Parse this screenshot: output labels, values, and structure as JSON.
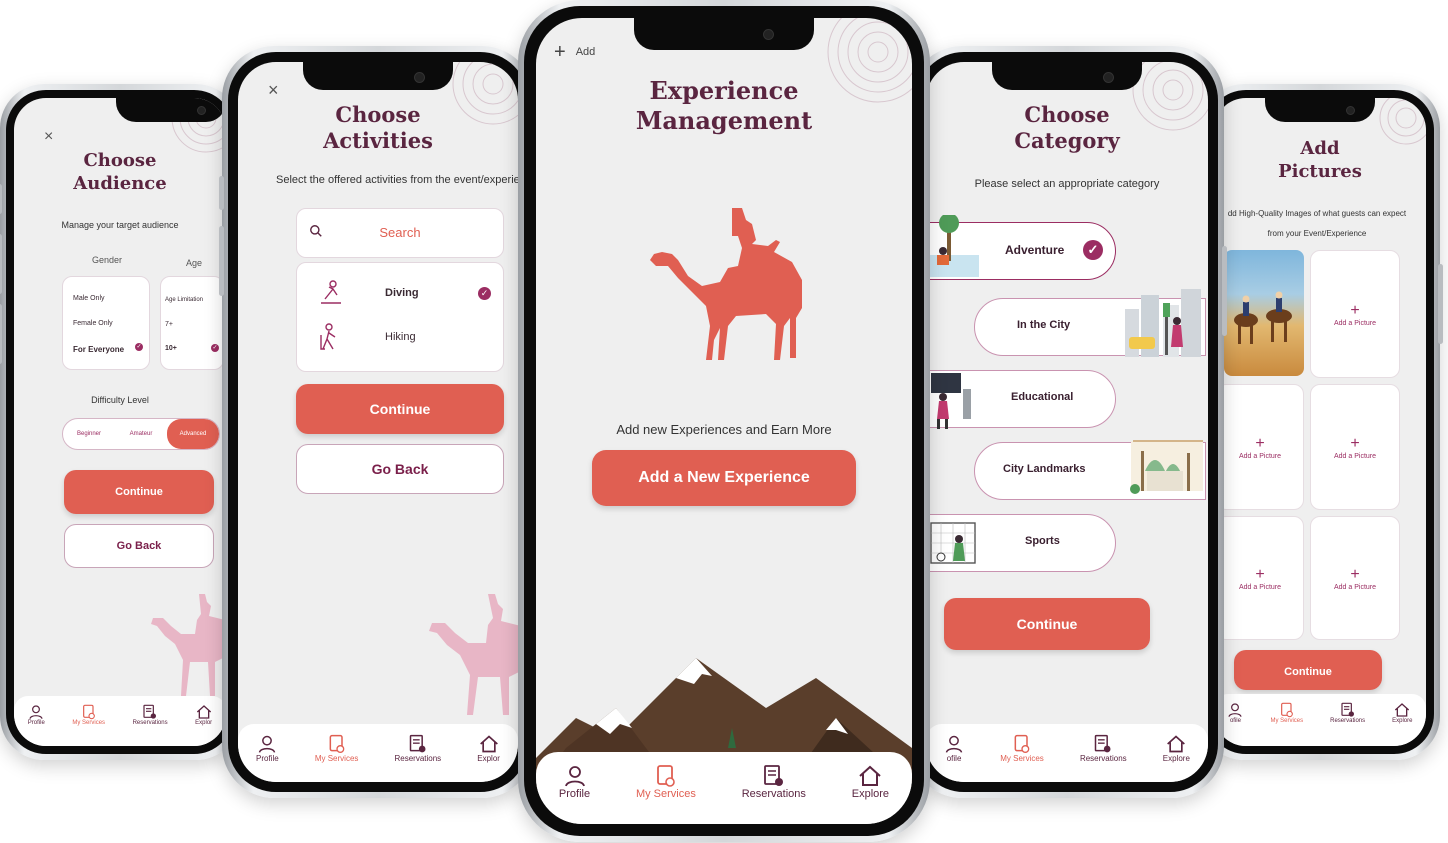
{
  "app": {
    "brand_color": "#e05f52",
    "title_color": "#5a2540",
    "accent_color": "#9b2d62"
  },
  "nav": {
    "profile": "Profile",
    "services": "My Services",
    "reservations": "Reservations",
    "explore": "Explore"
  },
  "nav_clipped": {
    "profile": "ofile",
    "explore": "Explor"
  },
  "screen1": {
    "close": "×",
    "title_line1": "Choose",
    "title_line2": "Audience",
    "subtitle": "Manage your target audience",
    "gender_label": "Gender",
    "age_label": "Age",
    "gender_options": [
      "Male Only",
      "Female Only",
      "For Everyone"
    ],
    "age_options": [
      "Age Limitation",
      "7+",
      "10+"
    ],
    "difficulty_label": "Difficulty Level",
    "difficulty_options": [
      "Beginner",
      "Amateur",
      "Advanced"
    ],
    "continue": "Continue",
    "go_back": "Go Back"
  },
  "screen2": {
    "close": "×",
    "title_line1": "Choose",
    "title_line2": "Activities",
    "subtitle": "Select the offered activities from the event/experienc",
    "search_placeholder": "Search",
    "activities": [
      "Diving",
      "Hiking"
    ],
    "continue": "Continue",
    "go_back": "Go Back"
  },
  "screen3": {
    "add": "Add",
    "title_line1": "Experience",
    "title_line2": "Management",
    "tagline": "Add new Experiences and Earn More",
    "cta": "Add a New Experience"
  },
  "screen4": {
    "title_line1": "Choose",
    "title_line2": "Category",
    "subtitle": "Please select an appropriate category",
    "categories": [
      "Adventure",
      "In the City",
      "Educational",
      "City Landmarks",
      "Sports"
    ],
    "continue": "Continue"
  },
  "screen5": {
    "title_line1": "Add",
    "title_line2": "Pictures",
    "subtitle_line1": "dd High-Quality Images of what guests can expect",
    "subtitle_line2": "from your Event/Experience",
    "add_picture": "Add a Picture",
    "continue": "Continue"
  }
}
